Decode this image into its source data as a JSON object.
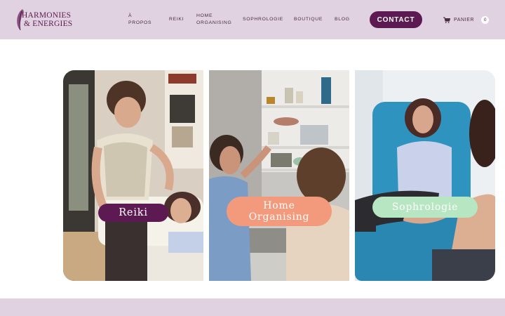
{
  "brand": {
    "line1": "HARMONIES",
    "line2": "& ENERGIES",
    "icon": "feather-icon"
  },
  "nav": {
    "apropos": "À PROPOS",
    "reiki": "REIKI",
    "home_organising": "HOME ORGANISING",
    "sophrologie": "SOPHROLOGIE",
    "boutique": "BOUTIQUE",
    "blog": "BLOG"
  },
  "contact_label": "CONTACT",
  "cart": {
    "icon": "cart-icon",
    "label": "PANIER",
    "count": "0"
  },
  "cards": [
    {
      "label": "Reiki",
      "pill_color": "#5d1a52"
    },
    {
      "label": "Home Organising",
      "pill_color": "#f49a7c"
    },
    {
      "label": "Sophrologie",
      "pill_color": "#b7e6c2"
    }
  ],
  "colors": {
    "header_bg": "#e1d2e1",
    "brand_purple": "#5d1a52"
  }
}
